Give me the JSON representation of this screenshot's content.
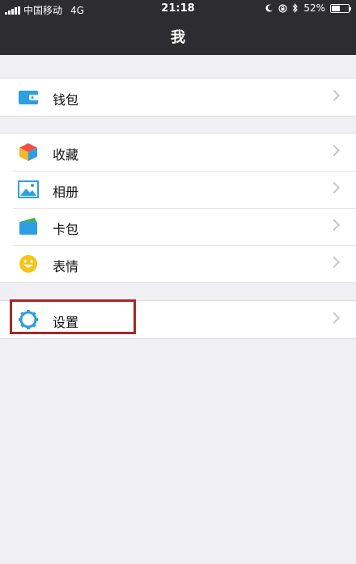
{
  "status_bar": {
    "carrier": "中国移动",
    "network": "4G",
    "time": "21:18",
    "battery_percent": "52%",
    "battery_level": 0.52
  },
  "nav": {
    "title": "我"
  },
  "groups": [
    {
      "items": [
        {
          "label": "钱包",
          "icon": "wallet-icon"
        }
      ]
    },
    {
      "items": [
        {
          "label": "收藏",
          "icon": "cube-icon"
        },
        {
          "label": "相册",
          "icon": "photo-icon"
        },
        {
          "label": "卡包",
          "icon": "card-icon"
        },
        {
          "label": "表情",
          "icon": "smiley-icon"
        }
      ]
    },
    {
      "items": [
        {
          "label": "设置",
          "icon": "gear-icon"
        }
      ]
    }
  ],
  "colors": {
    "nav_bg": "#2d2d31",
    "accent_blue": "#2d9fe0",
    "highlight": "#a72626"
  }
}
